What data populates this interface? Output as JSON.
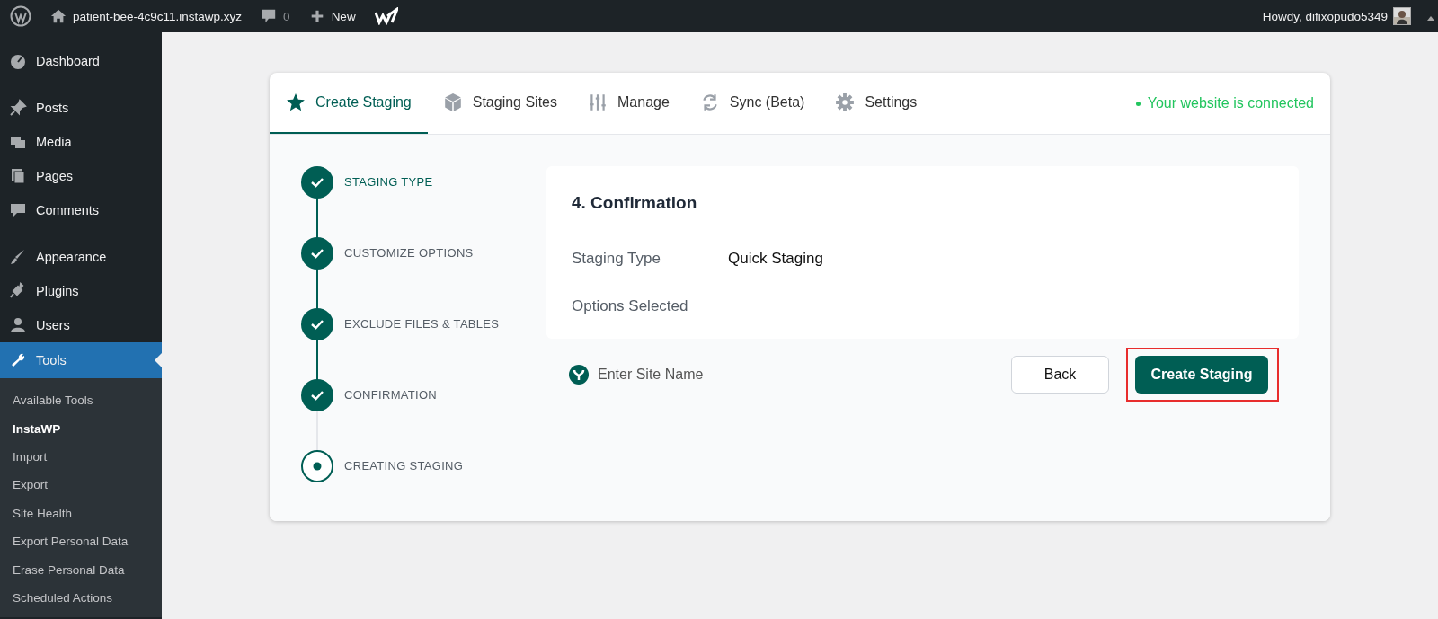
{
  "admin_bar": {
    "site": "patient-bee-4c9c11.instawp.xyz",
    "comments": "0",
    "new": "New",
    "greeting": "Howdy, difixopudo5349"
  },
  "sidebar": {
    "items": [
      {
        "label": "Dashboard",
        "selected": false
      },
      {
        "label": "Posts",
        "selected": false
      },
      {
        "label": "Media",
        "selected": false
      },
      {
        "label": "Pages",
        "selected": false
      },
      {
        "label": "Comments",
        "selected": false
      },
      {
        "label": "Appearance",
        "selected": false
      },
      {
        "label": "Plugins",
        "selected": false
      },
      {
        "label": "Users",
        "selected": false
      },
      {
        "label": "Tools",
        "selected": true
      }
    ],
    "submenu": [
      {
        "label": "Available Tools",
        "selected": false
      },
      {
        "label": "InstaWP",
        "selected": true
      },
      {
        "label": "Import",
        "selected": false
      },
      {
        "label": "Export",
        "selected": false
      },
      {
        "label": "Site Health",
        "selected": false
      },
      {
        "label": "Export Personal Data",
        "selected": false
      },
      {
        "label": "Erase Personal Data",
        "selected": false
      },
      {
        "label": "Scheduled Actions",
        "selected": false
      }
    ]
  },
  "tabs": [
    {
      "label": "Create Staging",
      "selected": true
    },
    {
      "label": "Staging Sites",
      "selected": false
    },
    {
      "label": "Manage",
      "selected": false
    },
    {
      "label": "Sync (Beta)",
      "selected": false
    },
    {
      "label": "Settings",
      "selected": false
    }
  ],
  "connection_status": "Your website is connected",
  "steps": [
    {
      "label": "STAGING TYPE",
      "completed": true
    },
    {
      "label": "CUSTOMIZE OPTIONS",
      "completed": true
    },
    {
      "label": "EXCLUDE FILES & TABLES",
      "completed": true
    },
    {
      "label": "CONFIRMATION",
      "completed": true
    },
    {
      "label": "CREATING STAGING",
      "completed": false
    }
  ],
  "confirmation": {
    "title": "4. Confirmation",
    "rows": [
      {
        "label": "Staging Type",
        "value": "Quick Staging"
      },
      {
        "label": "Options Selected"
      }
    ]
  },
  "site_name_link": "Enter Site Name",
  "buttons": [
    {
      "label": "Back",
      "kind": "secondary"
    },
    {
      "label": "Create Staging",
      "kind": "primary"
    }
  ]
}
